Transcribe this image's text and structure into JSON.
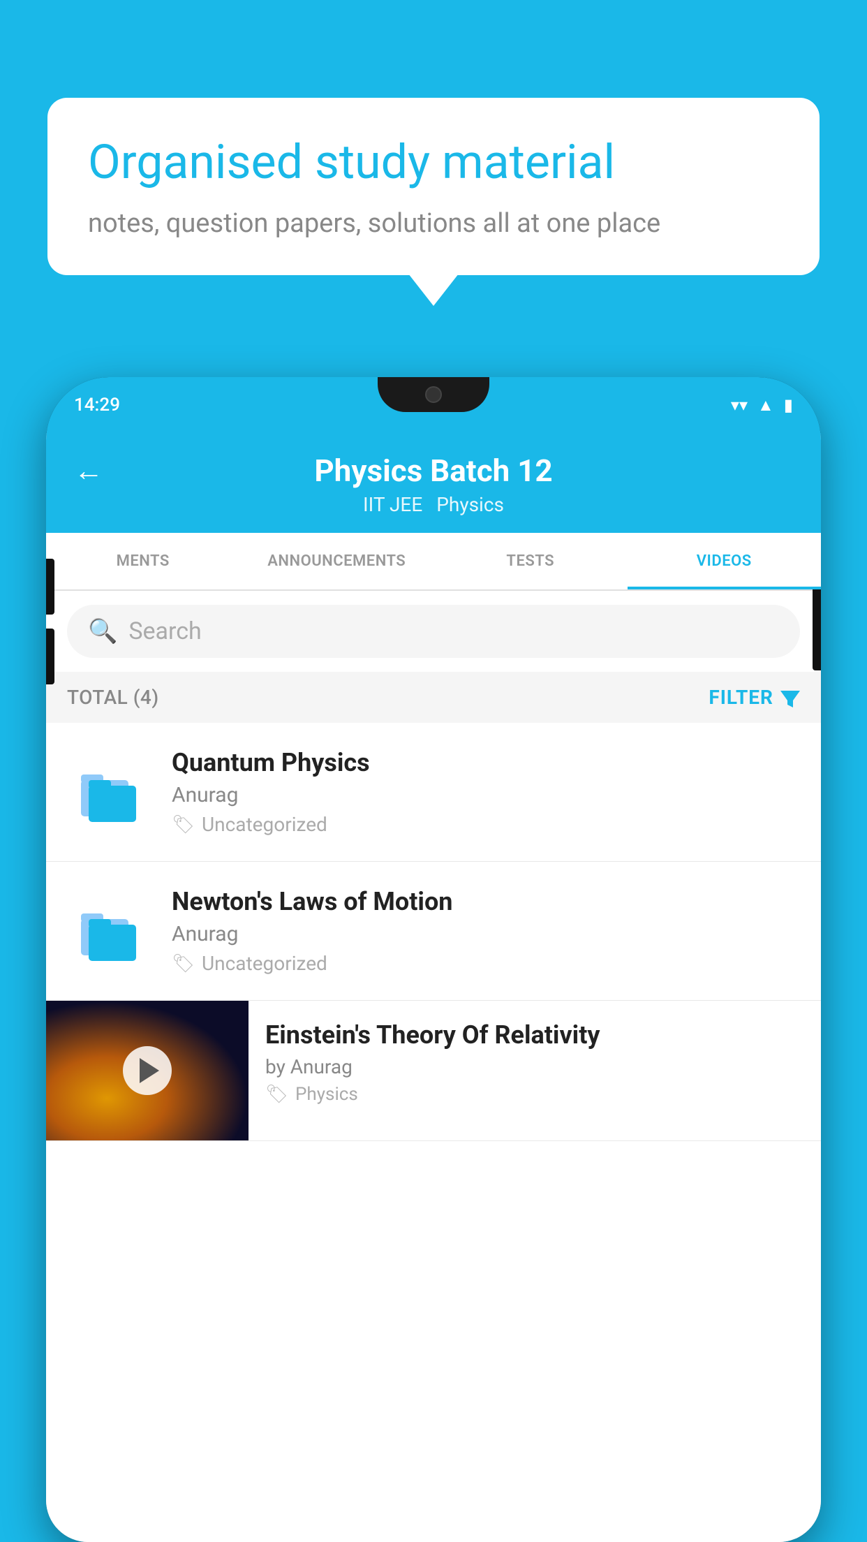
{
  "bubble": {
    "headline": "Organised study material",
    "subtext": "notes, question papers, solutions all at one place"
  },
  "phone": {
    "status_bar": {
      "time": "14:29"
    },
    "header": {
      "title": "Physics Batch 12",
      "subtitle1": "IIT JEE",
      "subtitle2": "Physics",
      "back_label": "←"
    },
    "tabs": [
      {
        "label": "MENTS",
        "active": false
      },
      {
        "label": "ANNOUNCEMENTS",
        "active": false
      },
      {
        "label": "TESTS",
        "active": false
      },
      {
        "label": "VIDEOS",
        "active": true
      }
    ],
    "search": {
      "placeholder": "Search"
    },
    "filter": {
      "total_label": "TOTAL (4)",
      "filter_label": "FILTER"
    },
    "videos": [
      {
        "id": "quantum",
        "title": "Quantum Physics",
        "author": "Anurag",
        "tag": "Uncategorized",
        "has_thumb": false
      },
      {
        "id": "newton",
        "title": "Newton's Laws of Motion",
        "author": "Anurag",
        "tag": "Uncategorized",
        "has_thumb": false
      },
      {
        "id": "einstein",
        "title": "Einstein's Theory Of Relativity",
        "author": "by Anurag",
        "tag": "Physics",
        "has_thumb": true
      }
    ]
  }
}
